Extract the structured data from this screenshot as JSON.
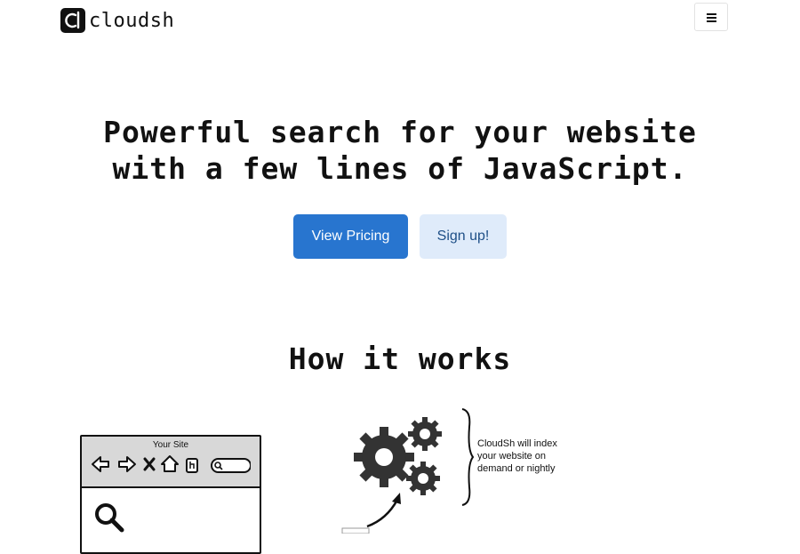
{
  "header": {
    "logo_text": "cloudsh",
    "logo_mark": "c",
    "menu_icon": "hamburger-menu-icon"
  },
  "hero": {
    "title_line1": "Powerful search for your website",
    "title_line2": "with a few lines of JavaScript.",
    "primary_button": "View Pricing",
    "secondary_button": "Sign up!"
  },
  "how_it_works": {
    "title": "How it works",
    "browser_label": "Your Site",
    "index_note": "CloudSh will index your website on demand or nightly"
  },
  "colors": {
    "primary": "#2875cf",
    "secondary_bg": "#dfebfa",
    "secondary_text": "#1e4f87",
    "text": "#111111"
  }
}
